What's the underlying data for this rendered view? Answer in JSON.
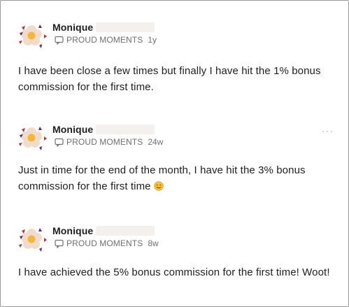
{
  "posts": [
    {
      "author": "Monique",
      "category": "PROUD MOMENTS",
      "age": "1y",
      "text": "I have been close a few times but finally I have hit the 1% bonus commission for the first time."
    },
    {
      "author": "Monique",
      "category": "PROUD MOMENTS",
      "age": "24w",
      "text": "Just in time for the end of the month, I have hit the 3% bonus commission for the first time"
    },
    {
      "author": "Monique",
      "category": "PROUD MOMENTS",
      "age": "8w",
      "text": "I have achieved the 5% bonus commission for the first time! Woot!"
    }
  ],
  "colors": {
    "avatar_petal": "#f1dccb",
    "avatar_center": "#f4b63e",
    "avatar_triangle_red": "#b8323a",
    "avatar_triangle_purple": "#5b2a6e",
    "muted_text": "#6f6f6f"
  },
  "icons": {
    "category": "chat-bubble-icon",
    "reaction": "smiling-face-emoji",
    "more": "more-dots-icon"
  }
}
